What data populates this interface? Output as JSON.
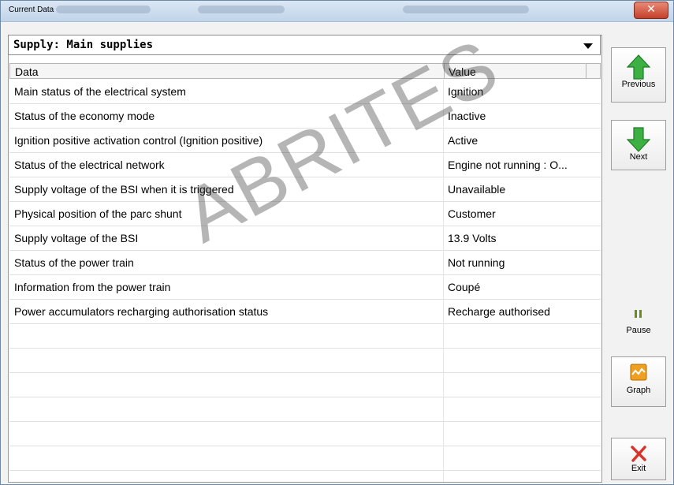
{
  "window": {
    "title": "Current Data"
  },
  "supply_select": {
    "value": "Supply: Main supplies"
  },
  "table": {
    "headers": {
      "data": "Data",
      "value": "Value"
    },
    "rows": [
      {
        "data": "Main status of the electrical system",
        "value": "Ignition"
      },
      {
        "data": "Status of the economy mode",
        "value": "Inactive"
      },
      {
        "data": "Ignition positive activation control  (Ignition positive)",
        "value": "Active"
      },
      {
        "data": "Status of the electrical network",
        "value": "Engine not running : O..."
      },
      {
        "data": "Supply voltage of the BSI when it is triggered",
        "value": "Unavailable"
      },
      {
        "data": "Physical position of the parc shunt",
        "value": "Customer"
      },
      {
        "data": "Supply voltage of the BSI",
        "value": "13.9 Volts"
      },
      {
        "data": "Status of the power train",
        "value": "Not running"
      },
      {
        "data": "Information from the power train",
        "value": "Coupé"
      },
      {
        "data": "Power accumulators recharging authorisation status",
        "value": "Recharge authorised"
      }
    ]
  },
  "watermark": "ABRITES",
  "buttons": {
    "previous": "Previous",
    "next": "Next",
    "pause": "Pause",
    "graph": "Graph",
    "exit": "Exit"
  },
  "colors": {
    "arrow_green": "#3cb043",
    "exit_red": "#d9342b",
    "graph_orange": "#f0a020"
  },
  "icons": [
    "up-arrow-icon",
    "down-arrow-icon",
    "pause-icon",
    "graph-icon",
    "close-x-icon"
  ]
}
